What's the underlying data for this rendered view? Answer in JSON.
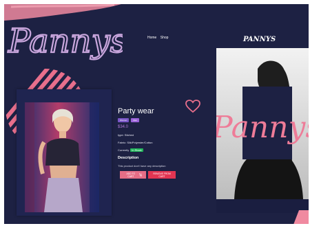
{
  "brand": {
    "logo_text": "Pannys",
    "logo_text_small": "PANNYS",
    "overlay_text": "Pannys"
  },
  "nav": {
    "items": [
      "Home",
      "Shop"
    ]
  },
  "product": {
    "title": "Party wear",
    "badges": [
      "Women",
      "Men"
    ],
    "price": "$34.0",
    "type_line": "type: Stiched",
    "fabric_line": "Fabric: Silk/Polyester/Cotton",
    "currently_label": "Currently",
    "stock_status": "In Stock",
    "description_heading": "Description",
    "description_text": "This product don't have any description",
    "add_button": "ADD TO CART",
    "remove_button": "REMOVE FROM CART"
  },
  "colors": {
    "background": "#1d2143",
    "accent_pink": "#e56d86",
    "accent_red": "#e23552",
    "price_purple": "#b07ad6",
    "stock_green": "#20b55a"
  },
  "icons": [
    "heart-icon",
    "cart-icon"
  ]
}
